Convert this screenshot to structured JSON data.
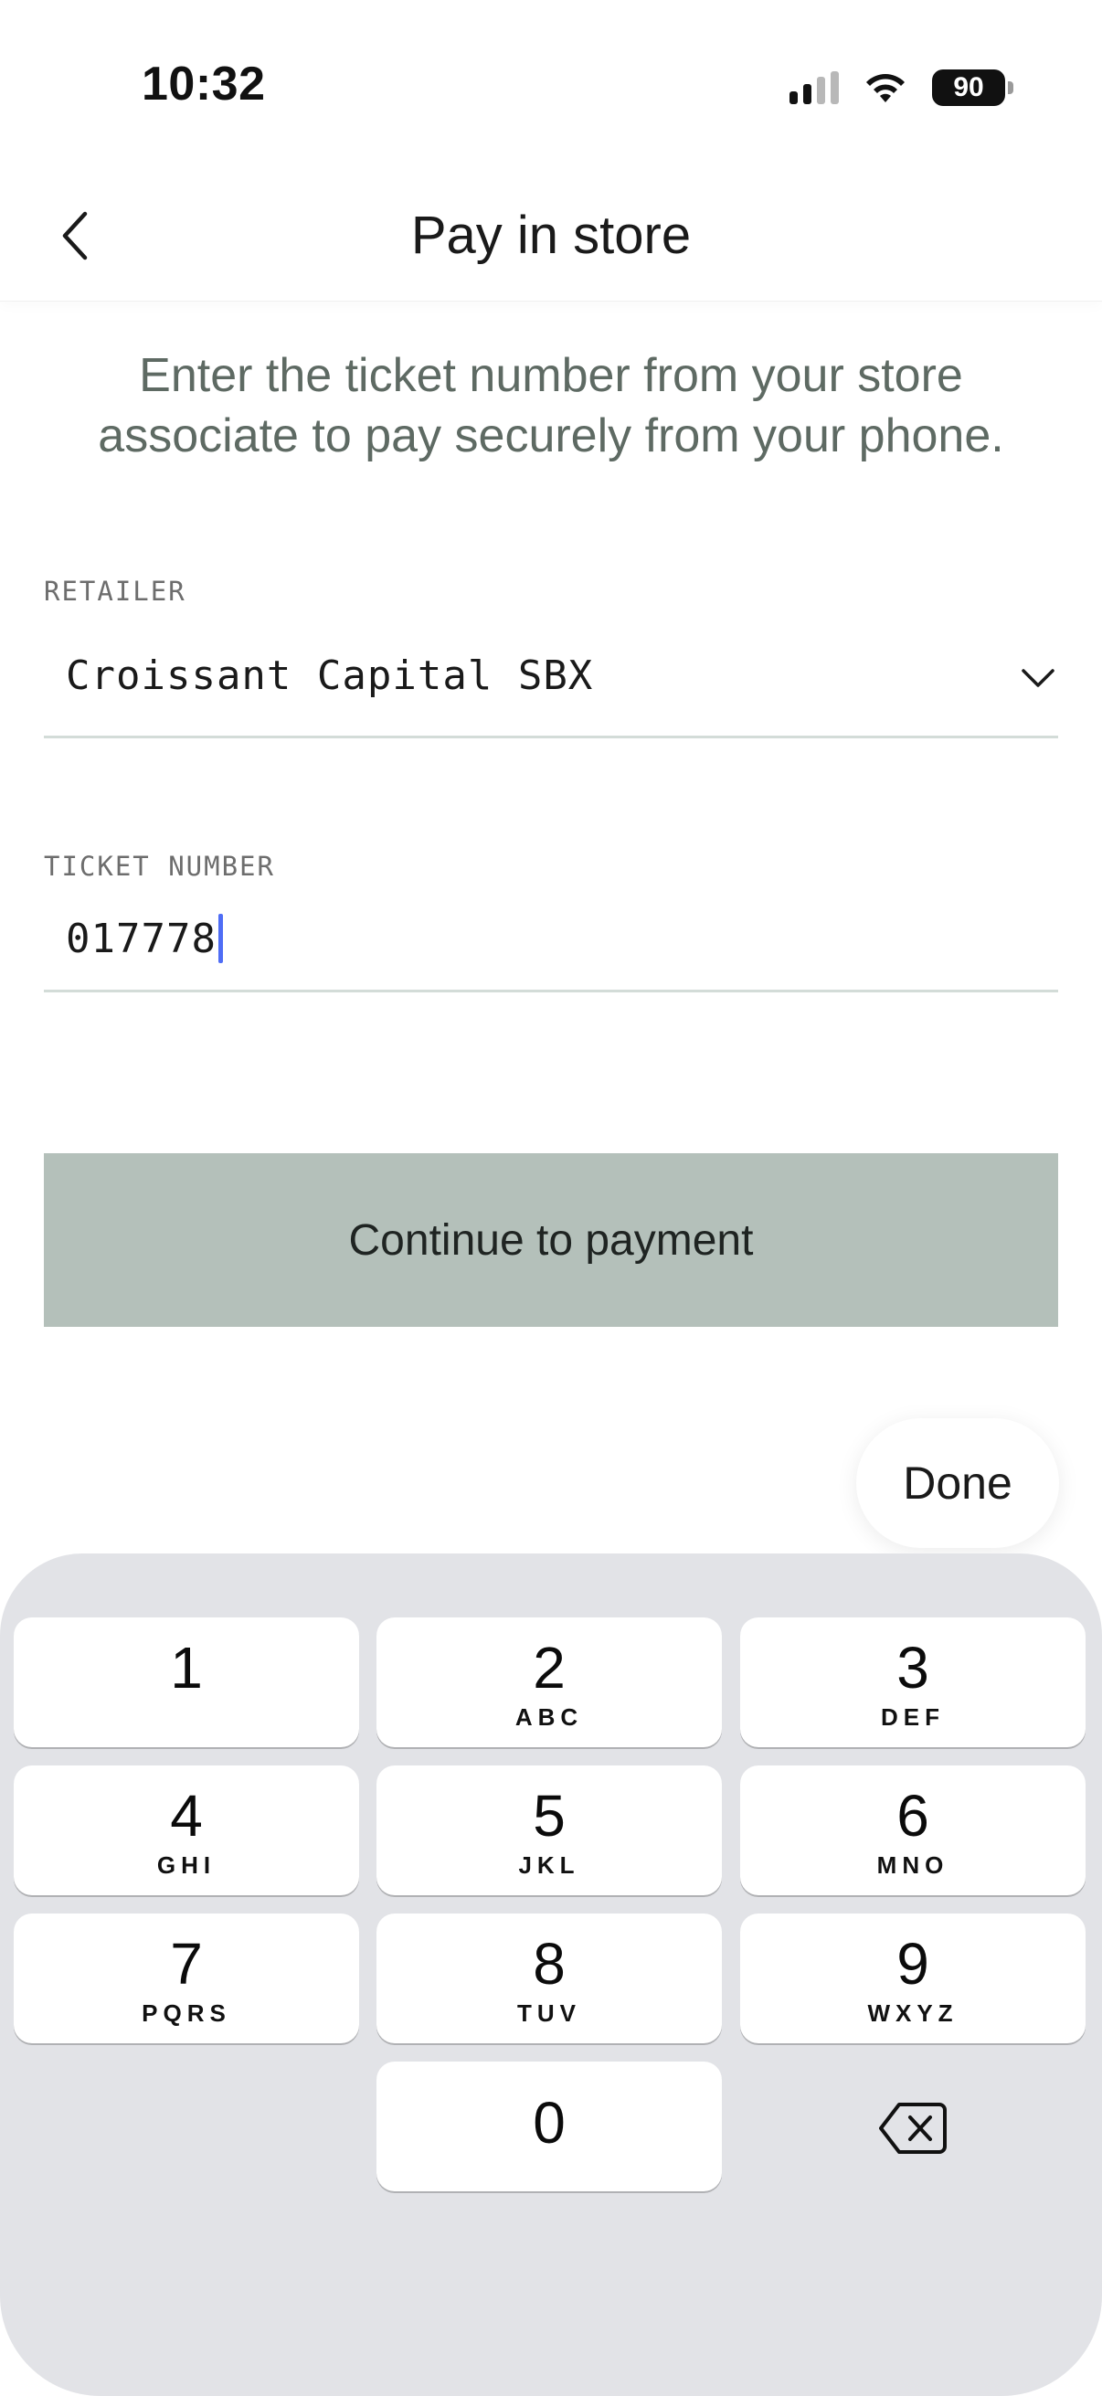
{
  "status_bar": {
    "time": "10:32",
    "battery": "90"
  },
  "header": {
    "title": "Pay in store"
  },
  "intro": {
    "text": "Enter the ticket number from your store associate to pay securely from your phone."
  },
  "retailer": {
    "label": "RETAILER",
    "value": "Croissant Capital SBX",
    "icon": "chevron-down-icon"
  },
  "ticket": {
    "label": "TICKET NUMBER",
    "value": "017778"
  },
  "continue_button": {
    "label": "Continue to payment"
  },
  "done_button": {
    "label": "Done"
  },
  "keypad": {
    "keys": [
      {
        "digit": "1",
        "letters": ""
      },
      {
        "digit": "2",
        "letters": "ABC"
      },
      {
        "digit": "3",
        "letters": "DEF"
      },
      {
        "digit": "4",
        "letters": "GHI"
      },
      {
        "digit": "5",
        "letters": "JKL"
      },
      {
        "digit": "6",
        "letters": "MNO"
      },
      {
        "digit": "7",
        "letters": "PQRS"
      },
      {
        "digit": "8",
        "letters": "TUV"
      },
      {
        "digit": "9",
        "letters": "WXYZ"
      },
      {
        "digit": "0",
        "letters": ""
      }
    ],
    "delete_icon": "delete-icon"
  },
  "colors": {
    "button_bg": "#b4c0ba",
    "intro_text": "#5e6a63",
    "caret": "#4f6df5",
    "keyboard_bg": "#e2e3e7"
  }
}
